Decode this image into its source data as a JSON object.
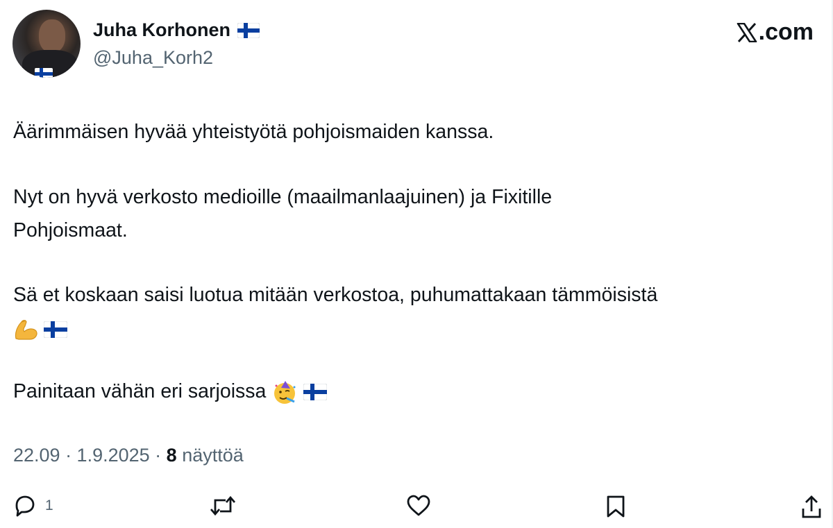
{
  "author": {
    "name": "Juha Korhonen",
    "handle": "@Juha_Korh2",
    "badge_icon": "finland-flag-icon"
  },
  "site": {
    "logo_text": ".com"
  },
  "post": {
    "line1": "Äärimmäisen hyvää yhteistyötä pohjoismaiden kanssa.",
    "line2": "Nyt on hyvä verkosto medioille (maailmanlaajuinen) ja Fixitille",
    "line3": "Pohjoismaat.",
    "line4": "Sä et koskaan saisi luotua mitään verkostoa, puhumattakaan tämmöisistä",
    "line5_icons": [
      "flexed-biceps-icon",
      "finland-flag-icon"
    ],
    "line6": "Painitaan vähän eri sarjoissa",
    "line6_icons": [
      "partying-face-icon",
      "finland-flag-icon"
    ]
  },
  "meta": {
    "time_date": "22.09 · 1.9.2025 · ",
    "views_count": "8",
    "views_label": " näyttöä"
  },
  "actions": {
    "reply_count": "1"
  },
  "colors": {
    "text": "#0f1419",
    "secondary": "#536471",
    "flag_blue": "#0a3fa0"
  }
}
